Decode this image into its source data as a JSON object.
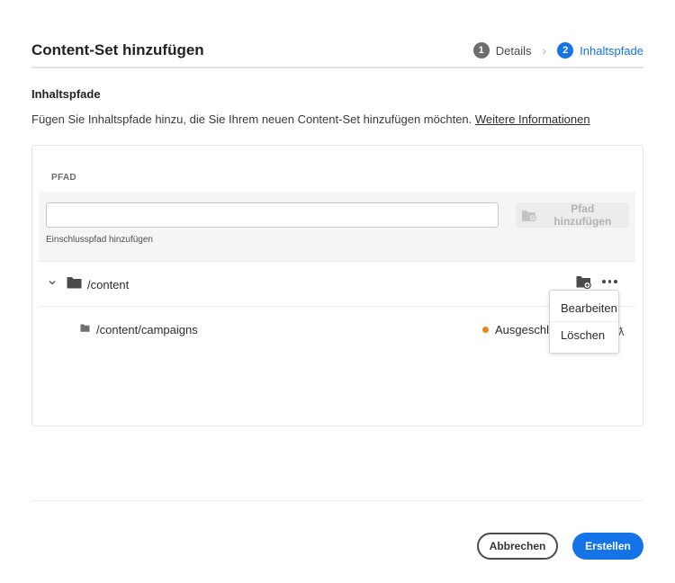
{
  "dialog": {
    "title": "Content-Set hinzufügen",
    "steps": [
      {
        "number": "1",
        "label": "Details"
      },
      {
        "number": "2",
        "label": "Inhaltspfade"
      }
    ]
  },
  "section": {
    "title": "Inhaltspfade",
    "description": "Fügen Sie Inhaltspfade hinzu, die Sie Ihrem neuen Content-Set hinzufügen möchten.",
    "link": "Weitere Informationen"
  },
  "table": {
    "column_header": "PFAD",
    "input_value": "",
    "helper": "Einschlusspfad hinzufügen",
    "add_button": "Pfad hinzufügen",
    "rows": [
      {
        "path": "/content",
        "expanded": true
      },
      {
        "path": "/content/campaigns",
        "status": "Ausgeschlo",
        "status_color": "#e68619"
      }
    ]
  },
  "context_menu": {
    "items": [
      "Bearbeiten",
      "Löschen"
    ]
  },
  "footer": {
    "cancel": "Abbrechen",
    "create": "Erstellen"
  },
  "colors": {
    "accent": "#1473e6",
    "status_excluded": "#e68619"
  }
}
